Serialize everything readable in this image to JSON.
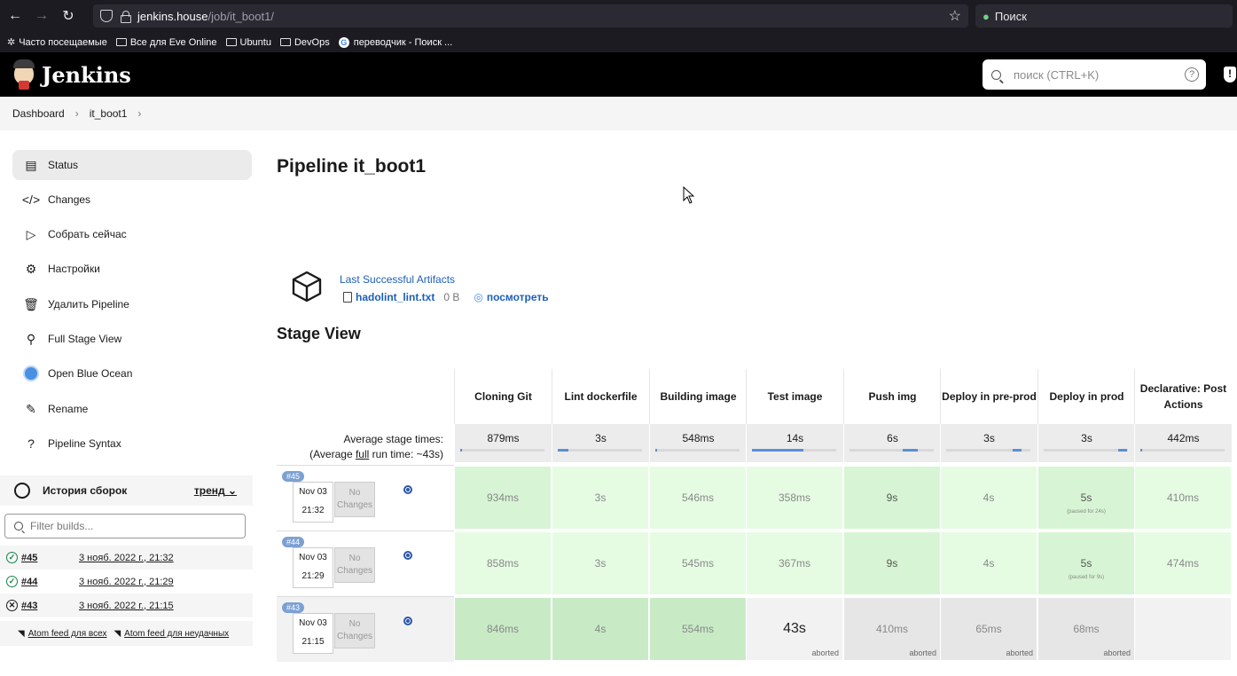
{
  "browser": {
    "url_host": "jenkins.house",
    "url_path": "/job/it_boot1/",
    "search_placeholder": "Поиск",
    "bookmarks": [
      "Часто посещаемые",
      "Все для Eve Online",
      "Ubuntu",
      "DevOps",
      "переводчик - Поиск ..."
    ]
  },
  "header": {
    "title": "Jenkins",
    "search_placeholder": "поиск (CTRL+K)",
    "help": "?",
    "security": "!"
  },
  "breadcrumb": [
    "Dashboard",
    "it_boot1"
  ],
  "sidebar": {
    "items": [
      {
        "label": "Status"
      },
      {
        "label": "Changes"
      },
      {
        "label": "Собрать сейчас"
      },
      {
        "label": "Настройки"
      },
      {
        "label": "Удалить Pipeline"
      },
      {
        "label": "Full Stage View"
      },
      {
        "label": "Open Blue Ocean"
      },
      {
        "label": "Rename"
      },
      {
        "label": "Pipeline Syntax"
      }
    ],
    "history": {
      "title": "История сборок",
      "trend": "тренд",
      "filter_placeholder": "Filter builds...",
      "builds": [
        {
          "num": "#45",
          "date": "3 нояб. 2022 г., 21:32",
          "status": "success"
        },
        {
          "num": "#44",
          "date": "3 нояб. 2022 г., 21:29",
          "status": "success"
        },
        {
          "num": "#43",
          "date": "3 нояб. 2022 г., 21:15",
          "status": "aborted"
        }
      ],
      "atom_all": "Atom feed для всех",
      "atom_failed": "Atom feed для неудачных"
    }
  },
  "main": {
    "title": "Pipeline it_boot1",
    "artifacts_title": "Last Successful Artifacts",
    "artifact_name": "hadolint_lint.txt",
    "artifact_size": "0 B",
    "artifact_view": "посмотреть",
    "stage_view_title": "Stage View"
  },
  "stage_view": {
    "avg_label_line1": "Average stage times:",
    "avg_label_prefix": "(Average ",
    "avg_label_full": "full",
    "avg_label_suffix": " run time: ~43s)",
    "stages": [
      "Cloning Git",
      "Lint dockerfile",
      "Building image",
      "Test image",
      "Push img",
      "Deploy in pre-prod",
      "Deploy in prod",
      "Declarative: Post Actions"
    ],
    "averages": [
      "879ms",
      "3s",
      "548ms",
      "14s",
      "6s",
      "3s",
      "3s",
      "442ms"
    ],
    "average_bar_fraction": [
      0.02,
      0.12,
      0.02,
      0.6,
      0.18,
      0.1,
      0.1,
      0.02
    ],
    "runs": [
      {
        "badge": "#45",
        "date": "Nov 03",
        "time": "21:32",
        "changes": "No Changes",
        "cells": [
          "934ms",
          "3s",
          "546ms",
          "358ms",
          "9s",
          "4s",
          "5s",
          "410ms"
        ],
        "notes": [
          "",
          "",
          "",
          "",
          "",
          "",
          "(paused for 24s)",
          ""
        ]
      },
      {
        "badge": "#44",
        "date": "Nov 03",
        "time": "21:29",
        "changes": "No Changes",
        "cells": [
          "858ms",
          "3s",
          "545ms",
          "367ms",
          "9s",
          "4s",
          "5s",
          "474ms"
        ],
        "notes": [
          "",
          "",
          "",
          "",
          "",
          "",
          "(paused for 9s)",
          ""
        ]
      },
      {
        "badge": "#43",
        "date": "Nov 03",
        "time": "21:15",
        "changes": "No Changes",
        "cells": [
          "846ms",
          "4s",
          "554ms",
          "43s",
          "410ms",
          "65ms",
          "68ms",
          ""
        ],
        "notes": [
          "",
          "",
          "",
          "aborted",
          "aborted",
          "aborted",
          "aborted",
          ""
        ]
      }
    ]
  }
}
